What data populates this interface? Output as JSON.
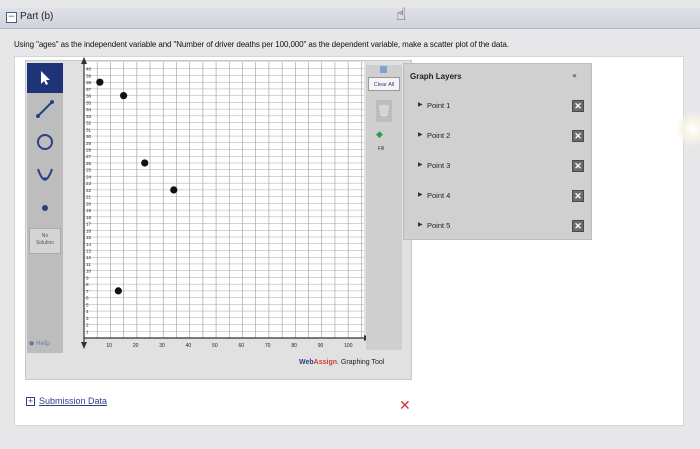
{
  "part": {
    "toggle": "−",
    "title": "Part (b)"
  },
  "question": "Using \"ages\" as the independent variable and \"Number of driver deaths per 100,000\" as the dependent variable, make a scatter plot of the data.",
  "toolbar": {
    "no_solution_line1": "No",
    "no_solution_line2": "Solution",
    "help": "Help"
  },
  "graph": {
    "x_ticks": [
      "10",
      "20",
      "30",
      "40",
      "50",
      "60",
      "70",
      "80",
      "90",
      "100"
    ],
    "y_ticks": [
      "1",
      "2",
      "3",
      "4",
      "5",
      "6",
      "7",
      "8",
      "9",
      "10",
      "11",
      "12",
      "13",
      "14",
      "15",
      "16",
      "17",
      "18",
      "19",
      "20",
      "21",
      "22",
      "23",
      "24",
      "25",
      "26",
      "27",
      "28",
      "29",
      "30",
      "31",
      "32",
      "33",
      "34",
      "35",
      "36",
      "37",
      "38",
      "39",
      "40"
    ],
    "points": [
      {
        "x": 6,
        "y": 38
      },
      {
        "x": 15,
        "y": 36
      },
      {
        "x": 23,
        "y": 26
      },
      {
        "x": 34,
        "y": 22
      },
      {
        "x": 13,
        "y": 7
      }
    ]
  },
  "right_tools": {
    "clear_all": "Clear All",
    "fill": "Fill"
  },
  "brand": {
    "web": "Web",
    "assign": "Assign",
    "rest": ". Graphing Tool"
  },
  "layers": {
    "title": "Graph Layers",
    "collapse": "«",
    "items": [
      {
        "label": "Point 1"
      },
      {
        "label": "Point 2"
      },
      {
        "label": "Point 3"
      },
      {
        "label": "Point 4"
      },
      {
        "label": "Point 5"
      }
    ]
  },
  "submission": {
    "toggle": "+",
    "label": "Submission Data"
  },
  "status_x": "✕"
}
